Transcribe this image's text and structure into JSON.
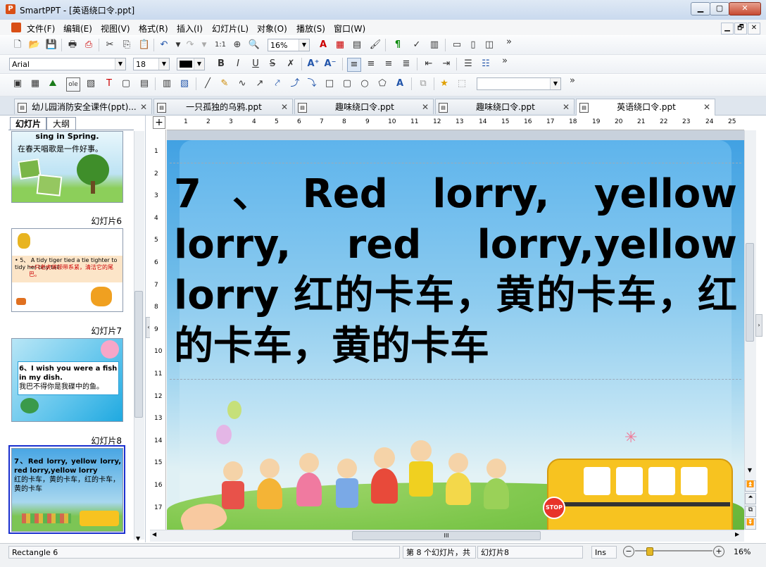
{
  "window": {
    "app_icon": "P",
    "title": "SmartPPT - [英语绕口令.ppt]",
    "min": "▁",
    "restore": "▢",
    "close": "✕"
  },
  "menu": [
    "文件(F)",
    "编辑(E)",
    "视图(V)",
    "格式(R)",
    "插入(I)",
    "幻灯片(L)",
    "对象(O)",
    "播放(S)",
    "窗口(W)"
  ],
  "mdi_controls": [
    "▁",
    "🗗",
    "✕"
  ],
  "toolbar1": {
    "zoom_value": "16%",
    "more": "»"
  },
  "toolbar2": {
    "font_name": "Arial",
    "font_size": "18",
    "bold": "B",
    "italic": "I",
    "underline": "U",
    "strike": "S",
    "more": "»"
  },
  "toolbar3": {
    "more": "»",
    "shape_select_value": ""
  },
  "doc_tabs": [
    {
      "label": "幼儿园消防安全课件(ppt)...",
      "active": false
    },
    {
      "label": "一只孤独的乌鸦.ppt",
      "active": false
    },
    {
      "label": "趣味绕口令.ppt",
      "active": false
    },
    {
      "label": "趣味绕口令.ppt",
      "active": false
    },
    {
      "label": "英语绕口令.ppt",
      "active": true
    }
  ],
  "panel_tabs": [
    "幻灯片",
    "大纲"
  ],
  "thumbnails": [
    {
      "label": "",
      "line1": "sing in Spring.",
      "line2": "在春天唱歌是一件好事。"
    },
    {
      "label": "幻灯片6",
      "line1": "• 5、 A tidy tiger tied a tie tighter to tidy her tiny tail.",
      "line2": "一只老虎将领带系紧，清洁它的尾巴。"
    },
    {
      "label": "幻灯片7",
      "line1": "6、I wish you were a fish in my dish.",
      "line2": "我巴不得你是我碟中的鱼。"
    },
    {
      "label": "幻灯片8",
      "line1": "7、Red lorry, yellow lorry, red lorry,yellow lorry",
      "line2": "红的卡车，黄的卡车，红的卡车，黄的卡车"
    }
  ],
  "ruler_h": [
    "1",
    "2",
    "3",
    "4",
    "5",
    "6",
    "7",
    "8",
    "9",
    "10",
    "11",
    "12",
    "13",
    "14",
    "15",
    "16",
    "17",
    "18",
    "19",
    "20",
    "21",
    "22",
    "23",
    "24",
    "25"
  ],
  "ruler_v": [
    "1",
    "2",
    "3",
    "4",
    "5",
    "6",
    "7",
    "8",
    "9",
    "10",
    "11",
    "12",
    "13",
    "14",
    "15",
    "16",
    "17"
  ],
  "slide": {
    "text": "7、Red lorry, yellow lorry, red lorry,yellow lorry 红的卡车，黄的卡车，红的卡车，黄的卡车",
    "bus_sign": "STOP"
  },
  "hscroll_grip": "III",
  "status": {
    "object": "Rectangle 6",
    "slide_pos": "第 8 个幻灯片，共",
    "slide_name": "幻灯片8",
    "ins": "Ins",
    "zoom": "16%",
    "zoom_minus": "−",
    "zoom_plus": "+"
  }
}
